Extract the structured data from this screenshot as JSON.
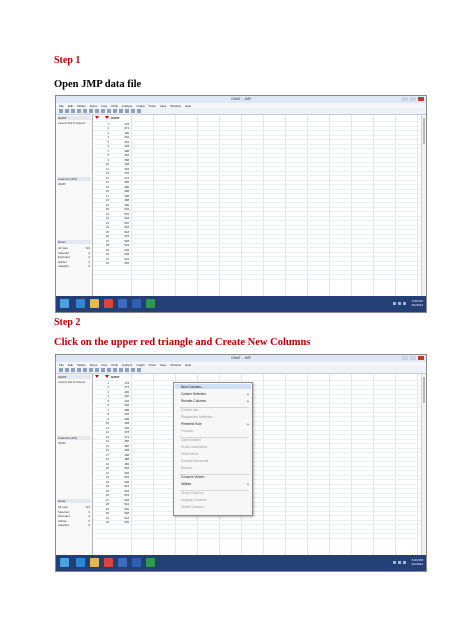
{
  "step1": {
    "label": "Step 1",
    "heading": "Open JMP data file"
  },
  "step2": {
    "label": "Step 2",
    "heading": "Click on the upper red triangle and Create New Columns"
  },
  "jmp": {
    "window_title": "GMAT - JMP",
    "menus": [
      "File",
      "Edit",
      "Tables",
      "Rows",
      "Cols",
      "DOE",
      "Analyze",
      "Graph",
      "Tools",
      "View",
      "Window",
      "Help"
    ],
    "table_panel_title": "GMAT",
    "table_panel_item": "Launch File  D:\\Users\\...",
    "columns_panel_title": "Columns (1/0)",
    "column_item": "GMAT",
    "rows_panel_title": "Rows",
    "row_states": [
      {
        "label": "All rows",
        "count": "724"
      },
      {
        "label": "Selected",
        "count": "0"
      },
      {
        "label": "Excluded",
        "count": "0"
      },
      {
        "label": "Hidden",
        "count": "0"
      },
      {
        "label": "Labelled",
        "count": "0"
      }
    ],
    "column_header": "GMAT",
    "rows": [
      {
        "n": "1",
        "v": "478"
      },
      {
        "n": "2",
        "v": "474"
      },
      {
        "n": "3",
        "v": "496"
      },
      {
        "n": "4",
        "v": "452"
      },
      {
        "n": "5",
        "v": "432"
      },
      {
        "n": "6",
        "v": "448"
      },
      {
        "n": "7",
        "v": "488"
      },
      {
        "n": "8",
        "v": "432"
      },
      {
        "n": "9",
        "v": "458"
      },
      {
        "n": "10",
        "v": "448"
      },
      {
        "n": "11",
        "v": "494"
      },
      {
        "n": "12",
        "v": "478"
      },
      {
        "n": "13",
        "v": "474"
      },
      {
        "n": "14",
        "v": "450"
      },
      {
        "n": "15",
        "v": "486"
      },
      {
        "n": "16",
        "v": "458"
      },
      {
        "n": "17",
        "v": "498"
      },
      {
        "n": "18",
        "v": "488"
      },
      {
        "n": "19",
        "v": "482"
      },
      {
        "n": "20",
        "v": "504"
      },
      {
        "n": "21",
        "v": "502"
      },
      {
        "n": "22",
        "v": "518"
      },
      {
        "n": "23",
        "v": "520"
      },
      {
        "n": "24",
        "v": "516"
      },
      {
        "n": "25",
        "v": "518"
      },
      {
        "n": "26",
        "v": "524"
      },
      {
        "n": "27",
        "v": "528"
      },
      {
        "n": "28",
        "v": "524"
      },
      {
        "n": "29",
        "v": "530"
      },
      {
        "n": "30",
        "v": "528"
      },
      {
        "n": "31",
        "v": "524"
      },
      {
        "n": "32",
        "v": "526"
      }
    ],
    "taskbar_time": "6:30 PM",
    "taskbar_date": "4/1/2013",
    "context_menu": [
      {
        "label": "New Columns...",
        "state": "highlight",
        "sub": false
      },
      {
        "label": "Column Selection",
        "state": "normal",
        "sub": true
      },
      {
        "label": "Reorder Columns",
        "state": "normal",
        "sub": true
      },
      {
        "label": "Column Info...",
        "state": "dim",
        "sub": false
      },
      {
        "label": "Standardize Attributes...",
        "state": "dim",
        "sub": false
      },
      {
        "label": "Preselect Role",
        "state": "normal",
        "sub": true
      },
      {
        "label": "Formula...",
        "state": "dim",
        "sub": false
      },
      {
        "label": "Label/Unlabel",
        "state": "dim",
        "sub": false
      },
      {
        "label": "Scroll Lock/Unlock",
        "state": "dim",
        "sub": false
      },
      {
        "label": "Hide/Unhide",
        "state": "dim",
        "sub": false
      },
      {
        "label": "Exclude/Unexclude",
        "state": "dim",
        "sub": false
      },
      {
        "label": "Recode...",
        "state": "dim",
        "sub": false
      },
      {
        "label": "Columns Viewer...",
        "state": "normal",
        "sub": false
      },
      {
        "label": "Utilities",
        "state": "normal",
        "sub": true
      },
      {
        "label": "Group Columns",
        "state": "dim",
        "sub": false
      },
      {
        "label": "Ungroup Columns",
        "state": "dim",
        "sub": false
      },
      {
        "label": "Delete Columns",
        "state": "dim",
        "sub": false
      }
    ]
  },
  "colors": {
    "step_red": "#c00000",
    "taskbar": "#243f76",
    "red_triangle": "#d00000"
  }
}
